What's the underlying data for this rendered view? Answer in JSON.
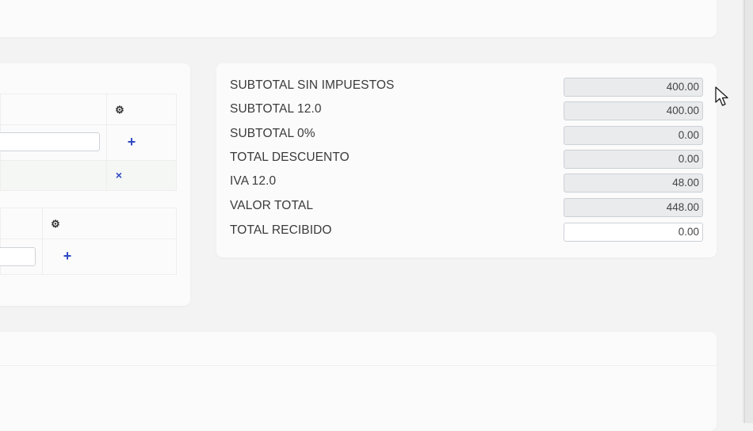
{
  "left_panel": {
    "table1": {
      "settings_icon": "gears-icon",
      "add_icon": "plus-icon",
      "remove_icon": "times-icon",
      "add_symbol": "+",
      "remove_symbol": "×",
      "settings_symbol": "⚙"
    },
    "table2": {
      "settings_icon": "gears-icon",
      "add_icon": "plus-icon",
      "add_symbol": "+",
      "settings_symbol": "⚙"
    }
  },
  "totals": [
    {
      "label": "SUBTOTAL SIN IMPUESTOS",
      "value": "400.00",
      "editable": false
    },
    {
      "label": "SUBTOTAL 12.0",
      "value": "400.00",
      "editable": false
    },
    {
      "label": "SUBTOTAL 0%",
      "value": "0.00",
      "editable": false
    },
    {
      "label": "TOTAL DESCUENTO",
      "value": "0.00",
      "editable": false
    },
    {
      "label": "IVA 12.0",
      "value": "48.00",
      "editable": false
    },
    {
      "label": "VALOR TOTAL",
      "value": "448.00",
      "editable": false
    },
    {
      "label": "TOTAL RECIBIDO",
      "value": "0.00",
      "editable": true
    }
  ],
  "colors": {
    "accent_icon": "#2f49c5",
    "readonly_field_bg": "#e9ebed",
    "page_bg": "#f3f3f4"
  }
}
